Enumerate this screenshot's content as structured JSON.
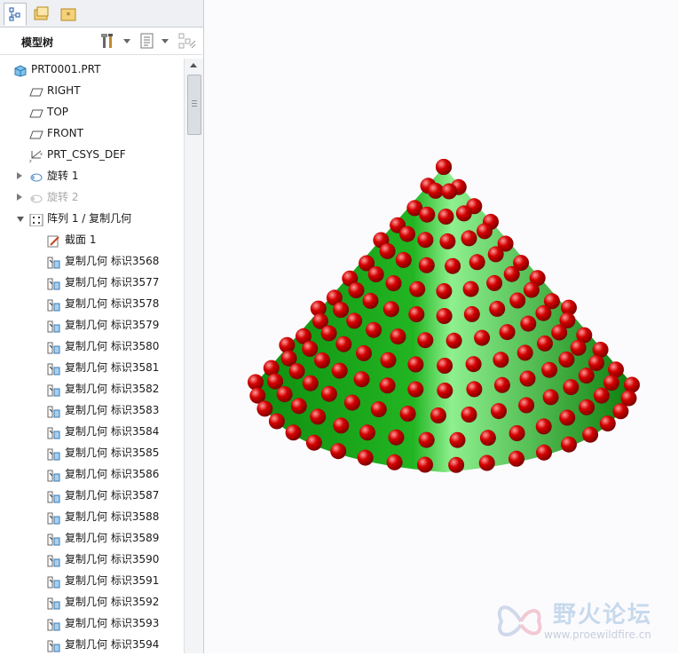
{
  "toolbar": {
    "title": "模型树"
  },
  "tree": {
    "items": [
      {
        "label": "PRT0001.PRT",
        "icon": "part-icon",
        "indent": 0,
        "expander": "none",
        "dim": false
      },
      {
        "label": "RIGHT",
        "icon": "datum-plane-icon",
        "indent": 1,
        "expander": "none",
        "dim": false
      },
      {
        "label": "TOP",
        "icon": "datum-plane-icon",
        "indent": 1,
        "expander": "none",
        "dim": false
      },
      {
        "label": "FRONT",
        "icon": "datum-plane-icon",
        "indent": 1,
        "expander": "none",
        "dim": false
      },
      {
        "label": "PRT_CSYS_DEF",
        "icon": "csys-icon",
        "indent": 1,
        "expander": "none",
        "dim": false
      },
      {
        "label": "旋转 1",
        "icon": "revolve-icon",
        "indent": 1,
        "expander": "closed",
        "dim": false
      },
      {
        "label": "旋转 2",
        "icon": "revolve-icon",
        "indent": 1,
        "expander": "closed",
        "dim": true
      },
      {
        "label": "阵列 1 / 复制几何",
        "icon": "pattern-icon",
        "indent": 1,
        "expander": "open",
        "dim": false
      },
      {
        "label": "截面 1",
        "icon": "sketch-icon",
        "indent": 2,
        "expander": "none",
        "dim": false
      },
      {
        "label": "复制几何 标识3568",
        "icon": "copy-geom-icon",
        "indent": 2,
        "expander": "none",
        "dim": false
      },
      {
        "label": "复制几何 标识3577",
        "icon": "copy-geom-icon",
        "indent": 2,
        "expander": "none",
        "dim": false
      },
      {
        "label": "复制几何 标识3578",
        "icon": "copy-geom-icon",
        "indent": 2,
        "expander": "none",
        "dim": false
      },
      {
        "label": "复制几何 标识3579",
        "icon": "copy-geom-icon",
        "indent": 2,
        "expander": "none",
        "dim": false
      },
      {
        "label": "复制几何 标识3580",
        "icon": "copy-geom-icon",
        "indent": 2,
        "expander": "none",
        "dim": false
      },
      {
        "label": "复制几何 标识3581",
        "icon": "copy-geom-icon",
        "indent": 2,
        "expander": "none",
        "dim": false
      },
      {
        "label": "复制几何 标识3582",
        "icon": "copy-geom-icon",
        "indent": 2,
        "expander": "none",
        "dim": false
      },
      {
        "label": "复制几何 标识3583",
        "icon": "copy-geom-icon",
        "indent": 2,
        "expander": "none",
        "dim": false
      },
      {
        "label": "复制几何 标识3584",
        "icon": "copy-geom-icon",
        "indent": 2,
        "expander": "none",
        "dim": false
      },
      {
        "label": "复制几何 标识3585",
        "icon": "copy-geom-icon",
        "indent": 2,
        "expander": "none",
        "dim": false
      },
      {
        "label": "复制几何 标识3586",
        "icon": "copy-geom-icon",
        "indent": 2,
        "expander": "none",
        "dim": false
      },
      {
        "label": "复制几何 标识3587",
        "icon": "copy-geom-icon",
        "indent": 2,
        "expander": "none",
        "dim": false
      },
      {
        "label": "复制几何 标识3588",
        "icon": "copy-geom-icon",
        "indent": 2,
        "expander": "none",
        "dim": false
      },
      {
        "label": "复制几何 标识3589",
        "icon": "copy-geom-icon",
        "indent": 2,
        "expander": "none",
        "dim": false
      },
      {
        "label": "复制几何 标识3590",
        "icon": "copy-geom-icon",
        "indent": 2,
        "expander": "none",
        "dim": false
      },
      {
        "label": "复制几何 标识3591",
        "icon": "copy-geom-icon",
        "indent": 2,
        "expander": "none",
        "dim": false
      },
      {
        "label": "复制几何 标识3592",
        "icon": "copy-geom-icon",
        "indent": 2,
        "expander": "none",
        "dim": false
      },
      {
        "label": "复制几何 标识3593",
        "icon": "copy-geom-icon",
        "indent": 2,
        "expander": "none",
        "dim": false
      },
      {
        "label": "复制几何 标识3594",
        "icon": "copy-geom-icon",
        "indent": 2,
        "expander": "none",
        "dim": false
      }
    ]
  },
  "viewport": {
    "model_colors": {
      "cone": "#22b522",
      "cone_light": "#8ef08e",
      "sphere": "#d40000",
      "sphere_highlight": "#ff9a9a"
    }
  },
  "watermark": {
    "title": "野火论坛",
    "url": "www.proewildfire.cn"
  }
}
